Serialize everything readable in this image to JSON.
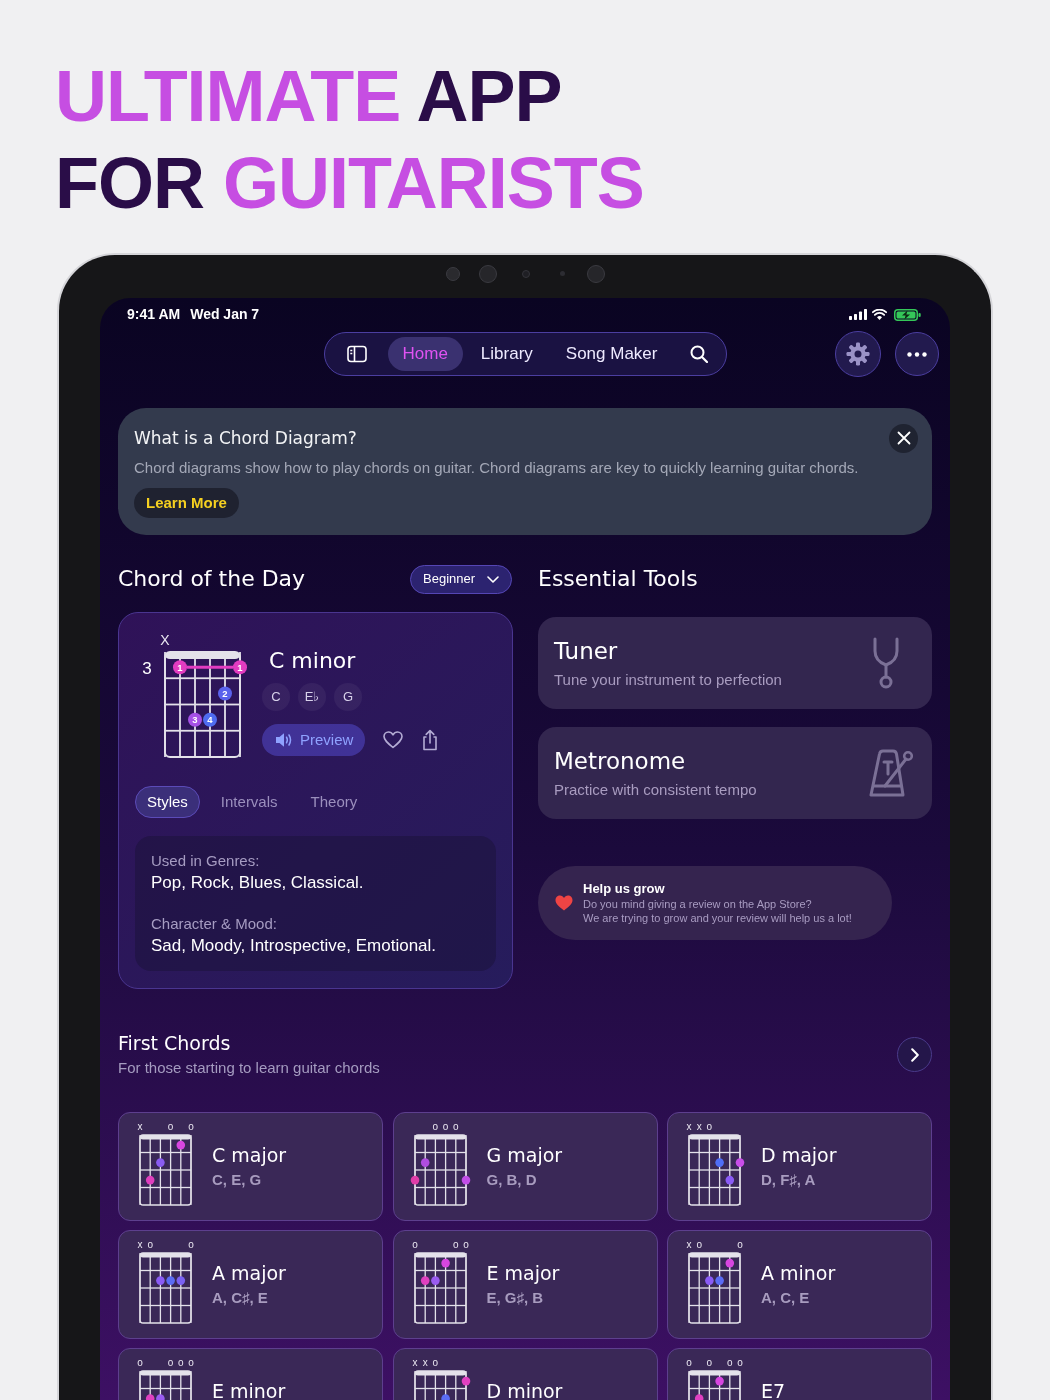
{
  "headline": {
    "lines": [
      [
        {
          "text": "ULTIMATE",
          "accent": true
        },
        {
          "text": "APP",
          "accent": false
        }
      ],
      [
        {
          "text": "FOR",
          "accent": false
        },
        {
          "text": "GUITARISTS",
          "accent": true
        }
      ]
    ]
  },
  "status_bar": {
    "time": "9:41 AM",
    "date": "Wed Jan 7",
    "battery_charging": true
  },
  "nav": {
    "tabs": [
      {
        "label": "Home",
        "selected": true
      },
      {
        "label": "Library",
        "selected": false
      },
      {
        "label": "Song Maker",
        "selected": false
      }
    ]
  },
  "banner": {
    "title": "What is a Chord Diagram?",
    "body": "Chord diagrams show how to play chords on guitar. Chord diagrams are key to quickly learning guitar chords.",
    "button": "Learn More"
  },
  "chord_of_the_day": {
    "title": "Chord of the Day",
    "level_menu": "Beginner",
    "chord": {
      "name": "C minor",
      "notes": [
        "C",
        "E♭",
        "G"
      ],
      "preview_button": "Preview",
      "fret_label": "3",
      "barre": true,
      "strings": [
        {
          "mark": "X",
          "frets": [
            false,
            false,
            false,
            false
          ]
        },
        {
          "frets": [
            true,
            false,
            false,
            false
          ],
          "color": "#e23cc0",
          "finger": "1"
        },
        {
          "frets": [
            false,
            false,
            true,
            false
          ],
          "color": "#a550e6",
          "finger": "3"
        },
        {
          "frets": [
            false,
            false,
            true,
            false
          ],
          "color": "#4f6cf0",
          "finger": "4"
        },
        {
          "frets": [
            false,
            true,
            false,
            false
          ],
          "color": "#5a62ec",
          "finger": "2"
        },
        {
          "frets": [
            true,
            false,
            false,
            false
          ],
          "color": "#e23cc0",
          "finger": "1"
        }
      ]
    },
    "tabs": [
      {
        "label": "Styles",
        "selected": true
      },
      {
        "label": "Intervals",
        "selected": false
      },
      {
        "label": "Theory",
        "selected": false
      }
    ],
    "details": [
      {
        "label": "Used in Genres:",
        "value": "Pop, Rock, Blues, Classical."
      },
      {
        "label": "Character & Mood:",
        "value": "Sad, Moody, Introspective, Emotional."
      }
    ]
  },
  "essential_tools": {
    "title": "Essential Tools",
    "tools": [
      {
        "kind": "tuner",
        "title": "Tuner",
        "subtitle": "Tune your instrument to perfection"
      },
      {
        "kind": "metronome",
        "title": "Metronome",
        "subtitle": "Practice with consistent tempo"
      }
    ]
  },
  "review_prompt": {
    "title": "Help us grow",
    "lines": [
      "Do you mind giving a review on the App Store?",
      "We are trying to grow and your review will help us a lot!"
    ]
  },
  "first_chords": {
    "title": "First Chords",
    "subtitle": "For those starting to learn guitar chords",
    "chords": [
      {
        "name": "C major",
        "notes": "C, E, G",
        "strings": [
          {
            "mark": "x",
            "frets": [
              false,
              false,
              false,
              false
            ]
          },
          {
            "frets": [
              false,
              false,
              true,
              false
            ],
            "color": "#e03fbe"
          },
          {
            "frets": [
              false,
              true,
              false,
              false
            ],
            "color": "#8a5cf2"
          },
          {
            "mark": "o",
            "frets": [
              false,
              false,
              false,
              false
            ]
          },
          {
            "frets": [
              true,
              false,
              false,
              false
            ],
            "color": "#d846e0"
          },
          {
            "mark": "o",
            "frets": [
              false,
              false,
              false,
              false
            ]
          }
        ]
      },
      {
        "name": "G major",
        "notes": "G, B, D",
        "strings": [
          {
            "frets": [
              false,
              false,
              true,
              false
            ],
            "color": "#e03ca8"
          },
          {
            "frets": [
              false,
              true,
              false,
              false
            ],
            "color": "#b04de0"
          },
          {
            "mark": "o",
            "frets": [
              false,
              false,
              false,
              false
            ]
          },
          {
            "mark": "o",
            "frets": [
              false,
              false,
              false,
              false
            ]
          },
          {
            "mark": "o",
            "frets": [
              false,
              false,
              false,
              false
            ]
          },
          {
            "frets": [
              false,
              false,
              true,
              false
            ],
            "color": "#c04ee6"
          }
        ]
      },
      {
        "name": "D major",
        "notes": "D, F♯, A",
        "strings": [
          {
            "mark": "x",
            "frets": [
              false,
              false,
              false,
              false
            ]
          },
          {
            "mark": "x",
            "frets": [
              false,
              false,
              false,
              false
            ]
          },
          {
            "mark": "o",
            "frets": [
              false,
              false,
              false,
              false
            ]
          },
          {
            "frets": [
              false,
              true,
              false,
              false
            ],
            "color": "#4f6ef7"
          },
          {
            "frets": [
              false,
              false,
              true,
              false
            ],
            "color": "#8b5cf6"
          },
          {
            "frets": [
              false,
              true,
              false,
              false
            ],
            "color": "#c84ee8"
          }
        ]
      },
      {
        "name": "A major",
        "notes": "A, C♯, E",
        "strings": [
          {
            "mark": "x",
            "frets": [
              false,
              false,
              false,
              false
            ]
          },
          {
            "mark": "o",
            "frets": [
              false,
              false,
              false,
              false
            ]
          },
          {
            "frets": [
              false,
              true,
              false,
              false
            ],
            "color": "#8b5cf6"
          },
          {
            "frets": [
              false,
              true,
              false,
              false
            ],
            "color": "#5b6cf5"
          },
          {
            "frets": [
              false,
              true,
              false,
              false
            ],
            "color": "#7a62f4"
          },
          {
            "mark": "o",
            "frets": [
              false,
              false,
              false,
              false
            ]
          }
        ]
      },
      {
        "name": "E major",
        "notes": "E, G♯, B",
        "strings": [
          {
            "mark": "o",
            "frets": [
              false,
              false,
              false,
              false
            ]
          },
          {
            "frets": [
              false,
              true,
              false,
              false
            ],
            "color": "#e040c0"
          },
          {
            "frets": [
              false,
              true,
              false,
              false
            ],
            "color": "#9a5cf0"
          },
          {
            "frets": [
              true,
              false,
              false,
              false
            ],
            "color": "#d846e0"
          },
          {
            "mark": "o",
            "frets": [
              false,
              false,
              false,
              false
            ]
          },
          {
            "mark": "o",
            "frets": [
              false,
              false,
              false,
              false
            ]
          }
        ]
      },
      {
        "name": "A minor",
        "notes": "A, C, E",
        "strings": [
          {
            "mark": "x",
            "frets": [
              false,
              false,
              false,
              false
            ]
          },
          {
            "mark": "o",
            "frets": [
              false,
              false,
              false,
              false
            ]
          },
          {
            "frets": [
              false,
              true,
              false,
              false
            ],
            "color": "#8b5cf6"
          },
          {
            "frets": [
              false,
              true,
              false,
              false
            ],
            "color": "#5b6cf5"
          },
          {
            "frets": [
              true,
              false,
              false,
              false
            ],
            "color": "#d846e0"
          },
          {
            "mark": "o",
            "frets": [
              false,
              false,
              false,
              false
            ]
          }
        ]
      },
      {
        "name": "E minor",
        "strings": [
          {
            "mark": "o",
            "frets": [
              false,
              false,
              false,
              false
            ]
          },
          {
            "frets": [
              false,
              true,
              false,
              false
            ],
            "color": "#e040c0"
          },
          {
            "frets": [
              false,
              true,
              false,
              false
            ],
            "color": "#9a5cf0"
          },
          {
            "mark": "o",
            "frets": [
              false,
              false,
              false,
              false
            ]
          },
          {
            "mark": "o",
            "frets": [
              false,
              false,
              false,
              false
            ]
          },
          {
            "mark": "o",
            "frets": [
              false,
              false,
              false,
              false
            ]
          }
        ]
      },
      {
        "name": "D minor",
        "strings": [
          {
            "mark": "x",
            "frets": [
              false,
              false,
              false,
              false
            ]
          },
          {
            "mark": "x",
            "frets": [
              false,
              false,
              false,
              false
            ]
          },
          {
            "mark": "o",
            "frets": [
              false,
              false,
              false,
              false
            ]
          },
          {
            "frets": [
              false,
              true,
              false,
              false
            ],
            "color": "#5b6cf5"
          },
          {
            "frets": [
              false,
              false,
              false,
              false
            ]
          },
          {
            "frets": [
              true,
              false,
              false,
              false
            ],
            "color": "#e040c0"
          }
        ]
      },
      {
        "name": "E7",
        "strings": [
          {
            "mark": "o",
            "frets": [
              false,
              false,
              false,
              false
            ]
          },
          {
            "frets": [
              false,
              true,
              false,
              false
            ],
            "color": "#e040c0"
          },
          {
            "mark": "o",
            "frets": [
              false,
              false,
              false,
              false
            ]
          },
          {
            "frets": [
              true,
              false,
              false,
              false
            ],
            "color": "#d846e0"
          },
          {
            "mark": "o",
            "frets": [
              false,
              false,
              false,
              false
            ]
          },
          {
            "mark": "o",
            "frets": [
              false,
              false,
              false,
              false
            ]
          }
        ]
      }
    ]
  }
}
